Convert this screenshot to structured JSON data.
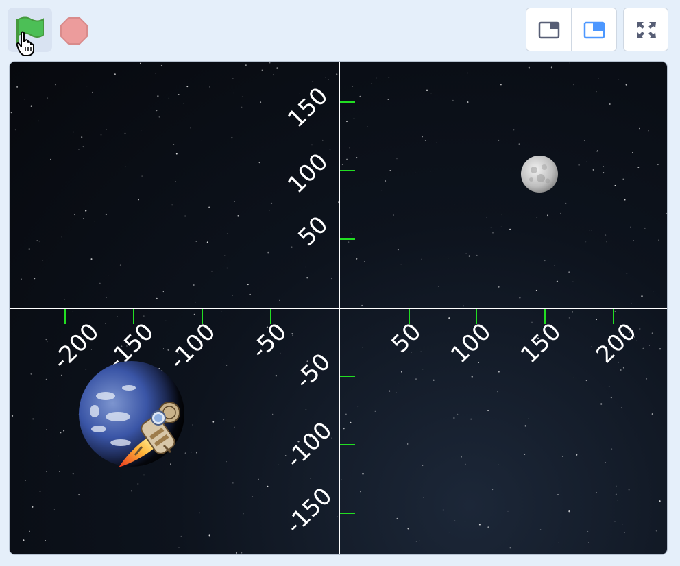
{
  "toolbar": {
    "green_flag_icon": "green-flag-icon",
    "stop_icon": "stop-sign-icon",
    "layout_buttons": [
      "small-stage-icon",
      "normal-stage-icon"
    ],
    "fullscreen_icon": "fullscreen-icon",
    "colors": {
      "flag": "#4cbf56",
      "stop": "#ec9c9c",
      "accent": "#4c97ff"
    }
  },
  "stage": {
    "backdrop": "stars",
    "axis_color": "#ffffff",
    "tick_color": "#22dd22",
    "x_labels": [
      "-200",
      "-150",
      "-100",
      "-50",
      "50",
      "100",
      "150",
      "200"
    ],
    "y_labels_pos": [
      "150",
      "100",
      "50"
    ],
    "y_labels_neg": [
      "-50",
      "-100",
      "-150"
    ],
    "sprites": [
      "moon",
      "earth",
      "rocket-cat"
    ]
  }
}
